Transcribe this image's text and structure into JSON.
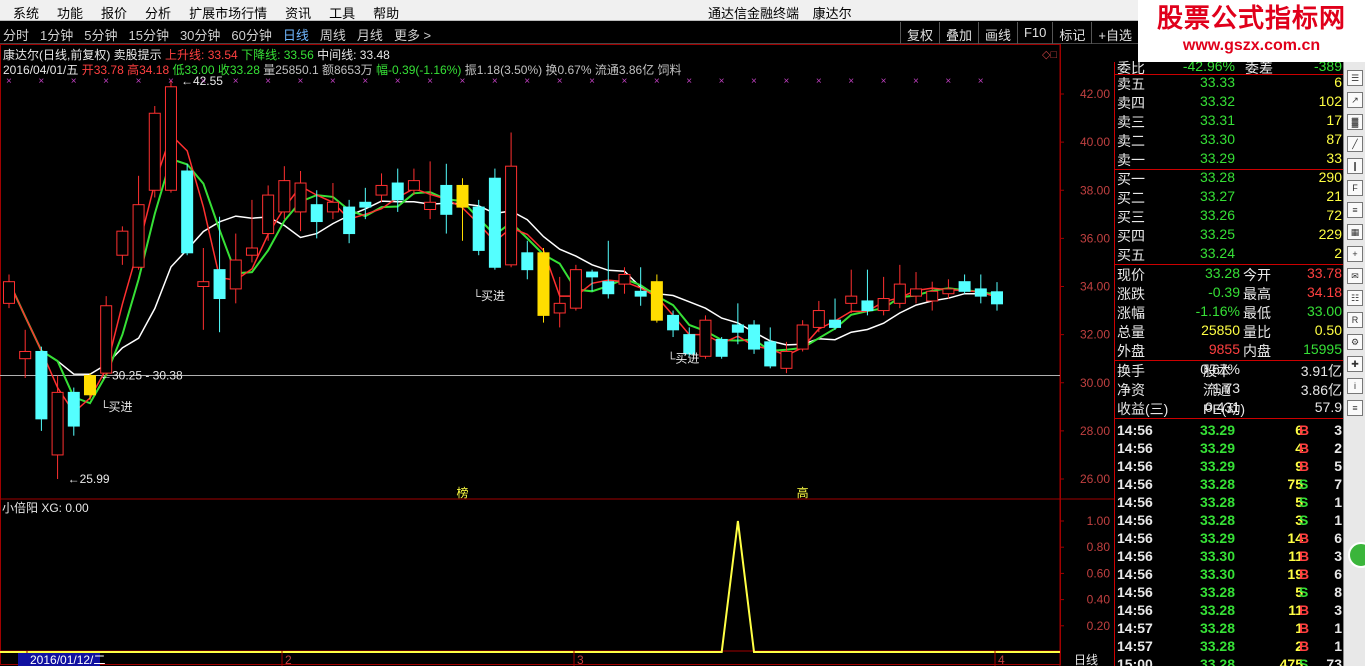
{
  "menu": {
    "items": [
      "系统",
      "功能",
      "报价",
      "分析",
      "扩展市场行情",
      "资讯",
      "工具",
      "帮助"
    ],
    "title_parts": [
      "通达信金融终端",
      "康达尔"
    ]
  },
  "watermark": {
    "title": "股票公式指标网",
    "url": "www.gszx.com.cn"
  },
  "toolbar": {
    "periods": [
      "分时",
      "1分钟",
      "5分钟",
      "15分钟",
      "30分钟",
      "60分钟",
      "日线",
      "周线",
      "月线",
      "更多 >"
    ],
    "active_period": "日线",
    "tools": [
      "复权",
      "叠加",
      "画线",
      "F10",
      "标记",
      "+自选"
    ]
  },
  "info": {
    "line1": {
      "name": "康达尔(日线,前复权)",
      "indicator": "卖股提示",
      "up_label": "上升线: 33.54",
      "down_label": "下降线: 33.56",
      "mid_label": "中间线: 33.48"
    },
    "line2": {
      "date": "2016/04/01/五",
      "open": "开33.78",
      "high": "高34.18",
      "low": "低33.00",
      "close": "收33.28",
      "vol": "量25850.1",
      "amount": "额8653万",
      "change": "幅-0.39(-1.16%)",
      "amp": "振1.18(3.50%)",
      "turnover": "换0.67%",
      "float": "流通3.86亿",
      "extra": "饲料"
    }
  },
  "chart_data": {
    "type": "candlestick",
    "price_axis": {
      "ticks": [
        "42.00",
        "40.00",
        "38.00",
        "36.00",
        "34.00",
        "32.00",
        "30.00",
        "28.00",
        "26.00"
      ],
      "min": 25.5,
      "max": 42.55
    },
    "candles": [
      {
        "o": 33.3,
        "c": 34.2,
        "h": 34.5,
        "l": 33.1
      },
      {
        "o": 31.0,
        "c": 31.3,
        "h": 32.2,
        "l": 30.2
      },
      {
        "o": 31.3,
        "c": 28.5,
        "h": 31.5,
        "l": 28.0
      },
      {
        "o": 27.0,
        "c": 29.6,
        "h": 30.3,
        "l": 26.0
      },
      {
        "o": 29.6,
        "c": 28.2,
        "h": 29.8,
        "l": 27.8
      },
      {
        "o": 29.5,
        "c": 30.3,
        "h": 30.4,
        "l": 29.3
      },
      {
        "o": 30.4,
        "c": 33.2,
        "h": 33.6,
        "l": 30.3
      },
      {
        "o": 35.3,
        "c": 36.3,
        "h": 36.5,
        "l": 34.9
      },
      {
        "o": 34.8,
        "c": 37.4,
        "h": 38.6,
        "l": 34.7
      },
      {
        "o": 38.0,
        "c": 41.2,
        "h": 41.5,
        "l": 37.7
      },
      {
        "o": 38.0,
        "c": 42.3,
        "h": 42.55,
        "l": 37.9
      },
      {
        "o": 38.8,
        "c": 35.4,
        "h": 39.1,
        "l": 35.3
      },
      {
        "o": 34.0,
        "c": 34.2,
        "h": 35.6,
        "l": 32.2
      },
      {
        "o": 34.7,
        "c": 33.5,
        "h": 36.9,
        "l": 32.1
      },
      {
        "o": 33.9,
        "c": 35.1,
        "h": 36.2,
        "l": 33.3
      },
      {
        "o": 35.3,
        "c": 35.6,
        "h": 37.6,
        "l": 35.0
      },
      {
        "o": 36.2,
        "c": 37.8,
        "h": 38.2,
        "l": 35.9
      },
      {
        "o": 37.1,
        "c": 38.4,
        "h": 39.0,
        "l": 36.8
      },
      {
        "o": 37.1,
        "c": 38.3,
        "h": 38.8,
        "l": 36.3
      },
      {
        "o": 37.4,
        "c": 36.7,
        "h": 38.0,
        "l": 36.0
      },
      {
        "o": 37.1,
        "c": 37.5,
        "h": 38.3,
        "l": 36.8
      },
      {
        "o": 37.3,
        "c": 36.2,
        "h": 37.6,
        "l": 35.8
      },
      {
        "o": 37.5,
        "c": 37.3,
        "h": 38.1,
        "l": 36.8
      },
      {
        "o": 37.8,
        "c": 38.2,
        "h": 38.7,
        "l": 37.5
      },
      {
        "o": 38.3,
        "c": 37.6,
        "h": 38.9,
        "l": 37.1
      },
      {
        "o": 38.0,
        "c": 38.4,
        "h": 38.9,
        "l": 37.8
      },
      {
        "o": 37.2,
        "c": 37.5,
        "h": 39.2,
        "l": 36.8
      },
      {
        "o": 38.2,
        "c": 37.0,
        "h": 39.1,
        "l": 36.2
      },
      {
        "o": 38.2,
        "c": 37.3,
        "h": 38.5,
        "l": 35.9
      },
      {
        "o": 37.3,
        "c": 35.5,
        "h": 37.6,
        "l": 35.3
      },
      {
        "o": 38.5,
        "c": 34.8,
        "h": 38.9,
        "l": 34.7
      },
      {
        "o": 34.9,
        "c": 39.0,
        "h": 40.4,
        "l": 34.8
      },
      {
        "o": 35.4,
        "c": 34.7,
        "h": 35.9,
        "l": 34.3
      },
      {
        "o": 35.4,
        "c": 32.8,
        "h": 35.6,
        "l": 32.5
      },
      {
        "o": 32.9,
        "c": 33.3,
        "h": 34.4,
        "l": 32.3
      },
      {
        "o": 33.1,
        "c": 34.7,
        "h": 34.9,
        "l": 33.0
      },
      {
        "o": 34.6,
        "c": 34.4,
        "h": 34.7,
        "l": 33.8
      },
      {
        "o": 34.2,
        "c": 33.7,
        "h": 35.9,
        "l": 33.5
      },
      {
        "o": 34.1,
        "c": 34.5,
        "h": 34.8,
        "l": 33.7
      },
      {
        "o": 33.8,
        "c": 33.6,
        "h": 34.8,
        "l": 33.2
      },
      {
        "o": 34.2,
        "c": 32.6,
        "h": 34.5,
        "l": 32.5
      },
      {
        "o": 32.8,
        "c": 32.2,
        "h": 33.0,
        "l": 31.9
      },
      {
        "o": 32.0,
        "c": 31.2,
        "h": 32.3,
        "l": 31.1
      },
      {
        "o": 31.1,
        "c": 32.6,
        "h": 32.8,
        "l": 31.0
      },
      {
        "o": 31.8,
        "c": 31.1,
        "h": 31.9,
        "l": 31.0
      },
      {
        "o": 32.4,
        "c": 32.1,
        "h": 33.3,
        "l": 31.6
      },
      {
        "o": 32.4,
        "c": 31.4,
        "h": 32.6,
        "l": 31.2
      },
      {
        "o": 31.7,
        "c": 30.7,
        "h": 32.3,
        "l": 30.6
      },
      {
        "o": 30.6,
        "c": 31.3,
        "h": 31.7,
        "l": 30.4
      },
      {
        "o": 31.4,
        "c": 32.4,
        "h": 32.6,
        "l": 31.3
      },
      {
        "o": 32.3,
        "c": 33.0,
        "h": 33.4,
        "l": 32.1
      },
      {
        "o": 32.6,
        "c": 32.3,
        "h": 33.5,
        "l": 32.2
      },
      {
        "o": 33.3,
        "c": 33.6,
        "h": 34.7,
        "l": 32.9
      },
      {
        "o": 33.4,
        "c": 33.0,
        "h": 34.7,
        "l": 32.8
      },
      {
        "o": 33.0,
        "c": 33.5,
        "h": 34.4,
        "l": 32.8
      },
      {
        "o": 33.3,
        "c": 34.1,
        "h": 34.9,
        "l": 33.1
      },
      {
        "o": 33.6,
        "c": 33.9,
        "h": 34.6,
        "l": 33.3
      },
      {
        "o": 33.4,
        "c": 33.8,
        "h": 34.2,
        "l": 33.0
      },
      {
        "o": 33.7,
        "c": 33.9,
        "h": 34.3,
        "l": 33.5
      },
      {
        "o": 34.2,
        "c": 33.8,
        "h": 34.5,
        "l": 33.7
      },
      {
        "o": 33.9,
        "c": 33.6,
        "h": 34.5,
        "l": 33.3
      },
      {
        "o": 33.78,
        "c": 33.28,
        "h": 34.18,
        "l": 33.0
      }
    ],
    "highlight_indices": [
      5,
      28,
      33,
      40
    ],
    "annotations": [
      {
        "text": "42.55",
        "index": 10,
        "price": 42.55
      },
      {
        "text": "25.99",
        "index": 3,
        "price": 26.0
      },
      {
        "text": "30.25 - 30.38",
        "index": 5,
        "price": 30.3
      },
      {
        "text": "买进",
        "index": 5,
        "price": 29.0
      },
      {
        "text": "买进",
        "index": 28,
        "price": 33.6
      },
      {
        "text": "买进",
        "index": 40,
        "price": 31.0
      }
    ],
    "markers": [
      {
        "text": "榜",
        "index": 28
      },
      {
        "text": "高",
        "index": 49
      }
    ],
    "support_level": 30.3,
    "sub": {
      "title": "小倍阳 XG: 0.00",
      "ticks": [
        "1.00",
        "0.80",
        "0.60",
        "0.40",
        "0.20"
      ],
      "spike_index": 45,
      "min": 0,
      "max": 1
    },
    "date_axis": [
      "2016/01/12/二",
      "2",
      "3",
      "4"
    ],
    "corner_label": "日线"
  },
  "quote": {
    "top_label": "委比",
    "top_value": "-42.96%",
    "top_label2": "委差",
    "top_value2": "-389",
    "sell": [
      {
        "label": "卖五",
        "price": "33.33",
        "vol": "6"
      },
      {
        "label": "卖四",
        "price": "33.32",
        "vol": "102"
      },
      {
        "label": "卖三",
        "price": "33.31",
        "vol": "17"
      },
      {
        "label": "卖二",
        "price": "33.30",
        "vol": "87"
      },
      {
        "label": "卖一",
        "price": "33.29",
        "vol": "33"
      }
    ],
    "buy": [
      {
        "label": "买一",
        "price": "33.28",
        "vol": "290"
      },
      {
        "label": "买二",
        "price": "33.27",
        "vol": "21"
      },
      {
        "label": "买三",
        "price": "33.26",
        "vol": "72"
      },
      {
        "label": "买四",
        "price": "33.25",
        "vol": "229"
      },
      {
        "label": "买五",
        "price": "33.24",
        "vol": "2"
      }
    ],
    "stats": [
      {
        "l1": "现价",
        "v1": "33.28",
        "c1": "#36e036",
        "l2": "今开",
        "v2": "33.78",
        "c2": "#ff4040"
      },
      {
        "l1": "涨跌",
        "v1": "-0.39",
        "c1": "#36e036",
        "l2": "最高",
        "v2": "34.18",
        "c2": "#ff4040"
      },
      {
        "l1": "涨幅",
        "v1": "-1.16%",
        "c1": "#36e036",
        "l2": "最低",
        "v2": "33.00",
        "c2": "#36e036"
      },
      {
        "l1": "总量",
        "v1": "25850",
        "c1": "#ffff44",
        "l2": "量比",
        "v2": "0.50",
        "c2": "#ffff44"
      },
      {
        "l1": "外盘",
        "v1": "9855",
        "c1": "#ff4040",
        "l2": "内盘",
        "v2": "15995",
        "c2": "#36e036"
      }
    ],
    "stats2": [
      {
        "l1": "换手",
        "v1": "0.67%",
        "l2": "股本",
        "v2": "3.91亿"
      },
      {
        "l1": "净资",
        "v1": "1.73",
        "l2": "流通",
        "v2": "3.86亿"
      },
      {
        "l1": "收益(三)",
        "v1": "0.431",
        "l2": "PE(动)",
        "v2": "57.9"
      }
    ],
    "ticks": [
      {
        "t": "14:56",
        "p": "33.29",
        "v": "6",
        "bs": "B",
        "n": "3"
      },
      {
        "t": "14:56",
        "p": "33.29",
        "v": "4",
        "bs": "B",
        "n": "2"
      },
      {
        "t": "14:56",
        "p": "33.29",
        "v": "9",
        "bs": "B",
        "n": "5"
      },
      {
        "t": "14:56",
        "p": "33.28",
        "v": "75",
        "bs": "S",
        "n": "7"
      },
      {
        "t": "14:56",
        "p": "33.28",
        "v": "5",
        "bs": "S",
        "n": "1"
      },
      {
        "t": "14:56",
        "p": "33.28",
        "v": "3",
        "bs": "S",
        "n": "1"
      },
      {
        "t": "14:56",
        "p": "33.29",
        "v": "14",
        "bs": "B",
        "n": "6"
      },
      {
        "t": "14:56",
        "p": "33.30",
        "v": "11",
        "bs": "B",
        "n": "3"
      },
      {
        "t": "14:56",
        "p": "33.30",
        "v": "19",
        "bs": "B",
        "n": "6"
      },
      {
        "t": "14:56",
        "p": "33.28",
        "v": "5",
        "bs": "S",
        "n": "8"
      },
      {
        "t": "14:56",
        "p": "33.28",
        "v": "11",
        "bs": "B",
        "n": "3"
      },
      {
        "t": "14:57",
        "p": "33.28",
        "v": "1",
        "bs": "B",
        "n": "1"
      },
      {
        "t": "14:57",
        "p": "33.28",
        "v": "2",
        "bs": "B",
        "n": "1"
      },
      {
        "t": "15:00",
        "p": "33.28",
        "v": "475",
        "bs": "S",
        "n": "73"
      }
    ]
  }
}
